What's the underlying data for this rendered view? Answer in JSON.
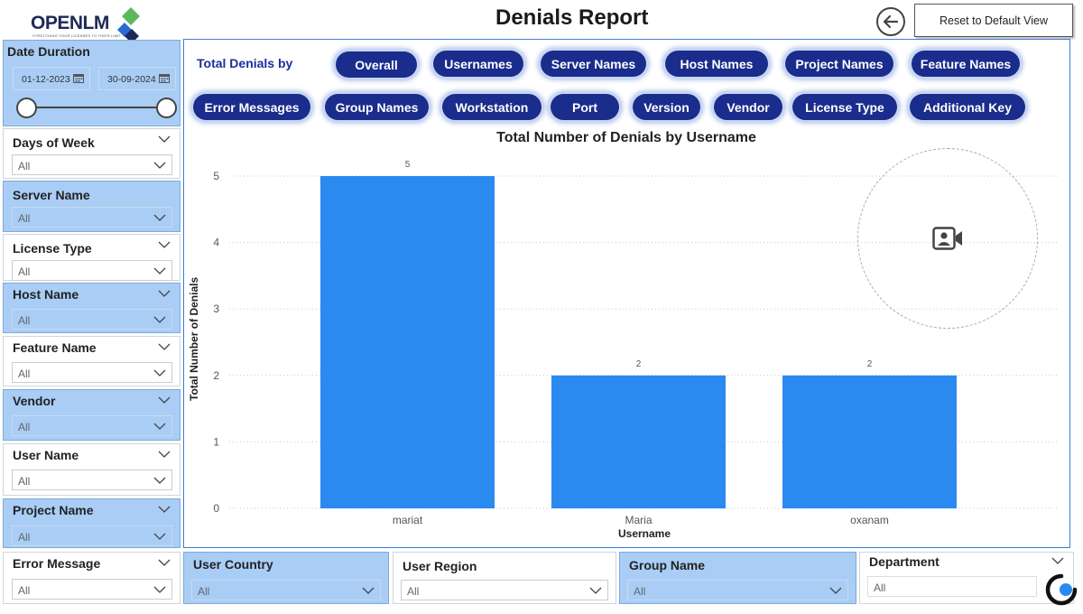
{
  "header": {
    "logo_text": "OPENLM",
    "logo_tagline": "STRETCHING YOUR LICENSES TO THEIR LIMIT",
    "title": "Denials Report",
    "reset_label": "Reset to Default View"
  },
  "filters": {
    "date_duration": {
      "label": "Date Duration",
      "start": "01-12-2023",
      "end": "30-09-2024"
    },
    "left": [
      {
        "label": "Days of Week",
        "value": "All"
      },
      {
        "label": "Server Name",
        "value": "All"
      },
      {
        "label": "License Type",
        "value": "All"
      },
      {
        "label": "Host Name",
        "value": "All"
      },
      {
        "label": "Feature Name",
        "value": "All"
      },
      {
        "label": "Vendor",
        "value": "All"
      },
      {
        "label": "User Name",
        "value": "All"
      },
      {
        "label": "Project Name",
        "value": "All"
      },
      {
        "label": "Error Message",
        "value": "All"
      }
    ],
    "bottom": [
      {
        "label": "User Country",
        "value": "All"
      },
      {
        "label": "User Region",
        "value": "All"
      },
      {
        "label": "Group Name",
        "value": "All"
      },
      {
        "label": "Department",
        "value": "All"
      }
    ]
  },
  "total_denials_by": {
    "label": "Total Denials by",
    "buttons": [
      "Overall",
      "Usernames",
      "Server Names",
      "Host Names",
      "Project Names",
      "Feature Names",
      "Error Messages",
      "Group Names",
      "Workstation",
      "Port",
      "Version",
      "Vendor",
      "License Type",
      "Additional Key"
    ]
  },
  "colors": {
    "bar": "#2a8af0",
    "pill": "#1a2c8c",
    "slicer_blue": "#a9cdf5"
  },
  "chart_data": {
    "type": "bar",
    "title": "Total Number of Denials by Username",
    "xlabel": "Username",
    "ylabel": "Total Number of Denials",
    "categories": [
      "mariat",
      "Maria",
      "oxanam"
    ],
    "values": [
      5,
      2,
      2
    ],
    "data_labels": [
      "5",
      "2",
      "2"
    ],
    "ylim": [
      0,
      5
    ],
    "yticks": [
      "0",
      "1",
      "2",
      "3",
      "4",
      "5"
    ],
    "grid": true
  }
}
